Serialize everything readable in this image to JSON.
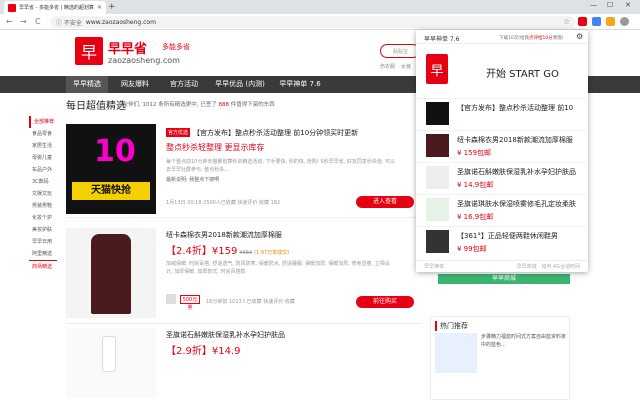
{
  "browser": {
    "tab_title": "早早省 - 多能多省 | 精选的超划算",
    "tab_close": "✕",
    "new_tab": "+",
    "minimize": "—",
    "maximize": "☐",
    "close": "✕",
    "back": "←",
    "forward": "→",
    "reload": "C",
    "security": "ⓘ 不安全",
    "url": "www.zaozaosheng.com",
    "star": "☆"
  },
  "site": {
    "logo_char": "早",
    "logo_name": "早早省",
    "logo_slogan": "多能多省",
    "logo_domain": "zaozaosheng.com",
    "search_placeholder": "贴贴宝",
    "hot_words": [
      "伤衣服",
      "女装",
      "零食"
    ]
  },
  "main_nav": [
    "早早精选",
    "网友爆料",
    "官方活动",
    "早早优品 (内测)",
    "早早神单 7.6"
  ],
  "daily": {
    "title": "每日超值精选",
    "stat_pre": "小伙伴们, 1012 条所有精选更中, 已签了",
    "stat_num": "888",
    "stat_post": "件值得下架的东西"
  },
  "sidebar": [
    "全部推荐",
    "食品零食",
    "家居生活",
    "母婴儿童",
    "车品户外",
    "3C数码",
    "文娱文玩",
    "男装男鞋",
    "化妆个护",
    "美妆护肤",
    "早早日用",
    "阿里精选",
    "商场精选"
  ],
  "cards": [
    {
      "badge": "官方优选",
      "title": "【官方发布】整点秒杀活动整理 前10分钟领买时更新",
      "subtitle": "整点秒杀轻整理 更显示库存",
      "desc": "每个整点前10分钟天猫聚划算秒杀精选活动, 下手要快, 秒的快, 抢购! 5秒早早省, 好友同享秒杀值, 可以去早早社群参与, 整点秒杀…",
      "tags": "最新说明: 我整点下架啊",
      "meta": "1月13日 20:18   2500人已收藏   快速评价   收藏 182",
      "button": "进入查看",
      "img_text_big": "10",
      "img_text": "天猫快抢"
    },
    {
      "title": "纽卡森棉衣男2018新款潮流加厚棉服",
      "price_tag": "【2.4折】",
      "price": "¥159",
      "price_orig": "¥659",
      "price_note": "(1.97万单成交)",
      "desc": "加绒保暖, 时尚百搭, 舒适透气, 防风防寒, 保暖防水, 舒适睡服, 保暖加厚, 保暖加厚, 修身显瘦, 立领设计, 加厚保暖, 加厚款式, 时尚百搭款",
      "coupon": "500元券",
      "meta": "16分钟前   1013人已收藏   快速评价   收藏",
      "button": "前往购买"
    },
    {
      "title": "圣旗诺石斛嫩肤保湿乳补水孕妇护肤品",
      "price_tag": "【2.9折】",
      "price": "¥14.9"
    }
  ],
  "right": {
    "green_button": "早早商城",
    "hot_title": "热门推荐",
    "hot_text": "步骤精力福蓝时间式方案自由蓝资料家中的蓝色…"
  },
  "popup": {
    "title": "早早神单 7.6",
    "rating_pre": "下载10次(给我",
    "rating_red": "点评给10分",
    "rating_post": "我哦)",
    "gear": "⚙",
    "logo_char": "早",
    "start": "开始 START GO",
    "items": [
      {
        "title": "【官方发布】整点秒杀活动整理 前10",
        "price": ""
      },
      {
        "title": "纽卡森棉衣男2018新款潮流加厚棉服",
        "price": "¥ 159包邮"
      },
      {
        "title": "圣旗诺石斛嫩肤保湿乳补水孕妇护肤品",
        "price": "¥ 14.9包邮"
      },
      {
        "title": "圣旗诺琪肤水保湿喷雾修毛孔定妆柔肤",
        "price": "¥ 16.9包邮"
      },
      {
        "title": "【361°】正品轻便两鞋休闲鞋男",
        "price": "¥ 99包邮"
      }
    ],
    "footer_left": "早早神单",
    "footer_right": "早早商城 · 如何 4G合适时间"
  },
  "colors": {
    "brand_red": "#e60012",
    "nav_dark": "#3a3a3a",
    "green": "#3cb371"
  }
}
